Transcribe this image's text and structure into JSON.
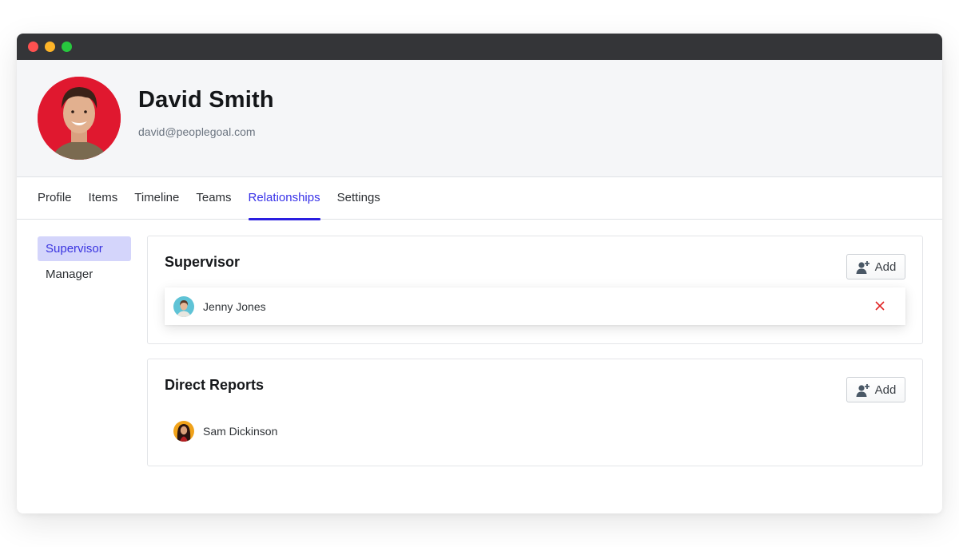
{
  "window": {
    "controls": [
      "close",
      "minimize",
      "maximize"
    ]
  },
  "profile": {
    "name": "David Smith",
    "email": "david@peoplegoal.com",
    "avatar_icon": "user-photo-avatar"
  },
  "tabs": [
    {
      "label": "Profile",
      "active": false
    },
    {
      "label": "Items",
      "active": false
    },
    {
      "label": "Timeline",
      "active": false
    },
    {
      "label": "Teams",
      "active": false
    },
    {
      "label": "Relationships",
      "active": true
    },
    {
      "label": "Settings",
      "active": false
    }
  ],
  "side_nav": [
    {
      "label": "Supervisor",
      "active": true
    },
    {
      "label": "Manager",
      "active": false
    }
  ],
  "supervisor_card": {
    "title": "Supervisor",
    "add_label": "Add",
    "people": [
      {
        "name": "Jenny Jones",
        "removable": true
      }
    ]
  },
  "reports_card": {
    "title": "Direct Reports",
    "add_label": "Add",
    "people": [
      {
        "name": "Sam Dickinson",
        "removable": false
      }
    ]
  },
  "colors": {
    "accent": "#3731e8",
    "active_nav_bg": "#d4d5fb",
    "remove": "#e02424",
    "titlebar": "#343538"
  }
}
